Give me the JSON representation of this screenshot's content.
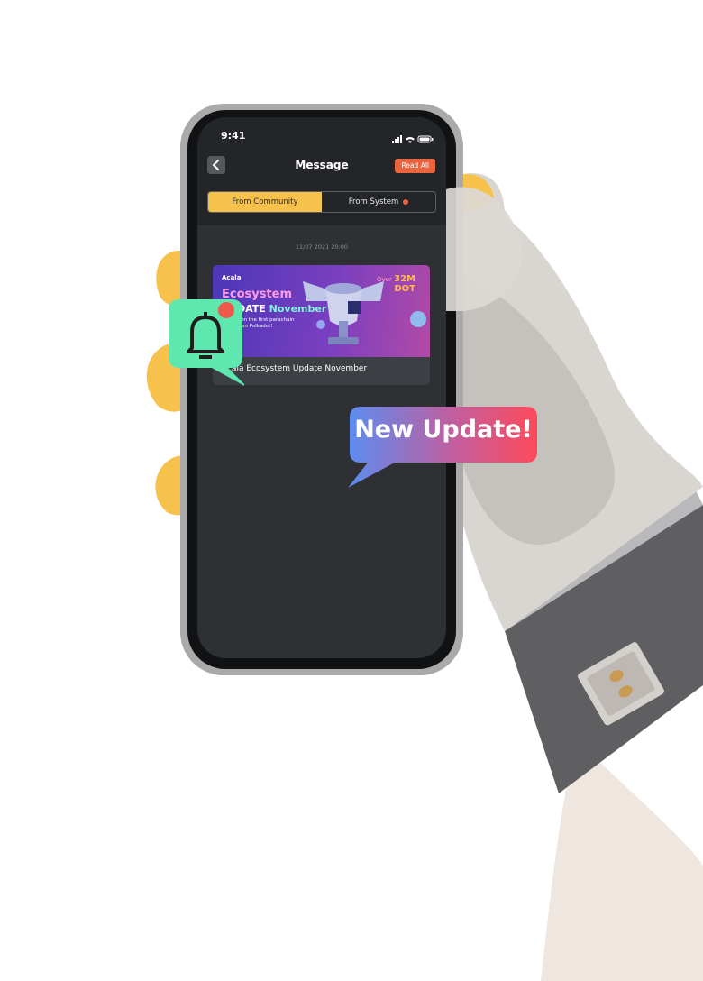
{
  "status_bar": {
    "time": "9:41"
  },
  "header": {
    "title": "Message",
    "read_all_label": "Read All"
  },
  "tabs": [
    {
      "label": "From Community",
      "active": true
    },
    {
      "label": "From System",
      "active": false,
      "has_unread": true
    }
  ],
  "messages": [
    {
      "timestamp": "11/07 2021 20:00",
      "banner": {
        "brand": "Acala",
        "headline_1": "Ecosystem",
        "headline_2_prefix": "UPDATE",
        "headline_2_suffix": "November",
        "subtext": "Acala won the first parachain auction on Polkadot!",
        "over_label": "Over",
        "amount": "32M",
        "unit": "DOT"
      },
      "title": "Acala Ecosystem Update November"
    }
  ],
  "callouts": {
    "update_text": "New Update!"
  },
  "colors": {
    "accent_yellow": "#f6c24b",
    "accent_orange": "#e8653f",
    "screen_bg": "#2e3034",
    "bell_green": "#5ee8b0"
  },
  "icons": [
    "back-arrow-icon",
    "signal-icon",
    "wifi-icon",
    "battery-icon",
    "bell-icon",
    "trophy-icon"
  ]
}
